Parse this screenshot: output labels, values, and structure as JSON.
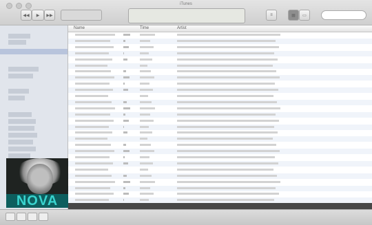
{
  "window": {
    "title": "iTunes"
  },
  "player": {
    "now_playing_line1": "",
    "now_playing_line2": ""
  },
  "search": {
    "placeholder": ""
  },
  "sidebar": {
    "album_art_label": "NOVA"
  },
  "list": {
    "columns": [
      "Name",
      "",
      "Time",
      "Artist"
    ],
    "row_count": 28
  },
  "footer": {
    "left_text": "",
    "right_text": ""
  },
  "status": {
    "summary": ""
  },
  "colors": {
    "sidebar_selected": "#b8c4dc",
    "row_alternate": "#f0f4fa",
    "album_banner": "#0d5e5e",
    "album_banner_text": "#39d4cf"
  }
}
